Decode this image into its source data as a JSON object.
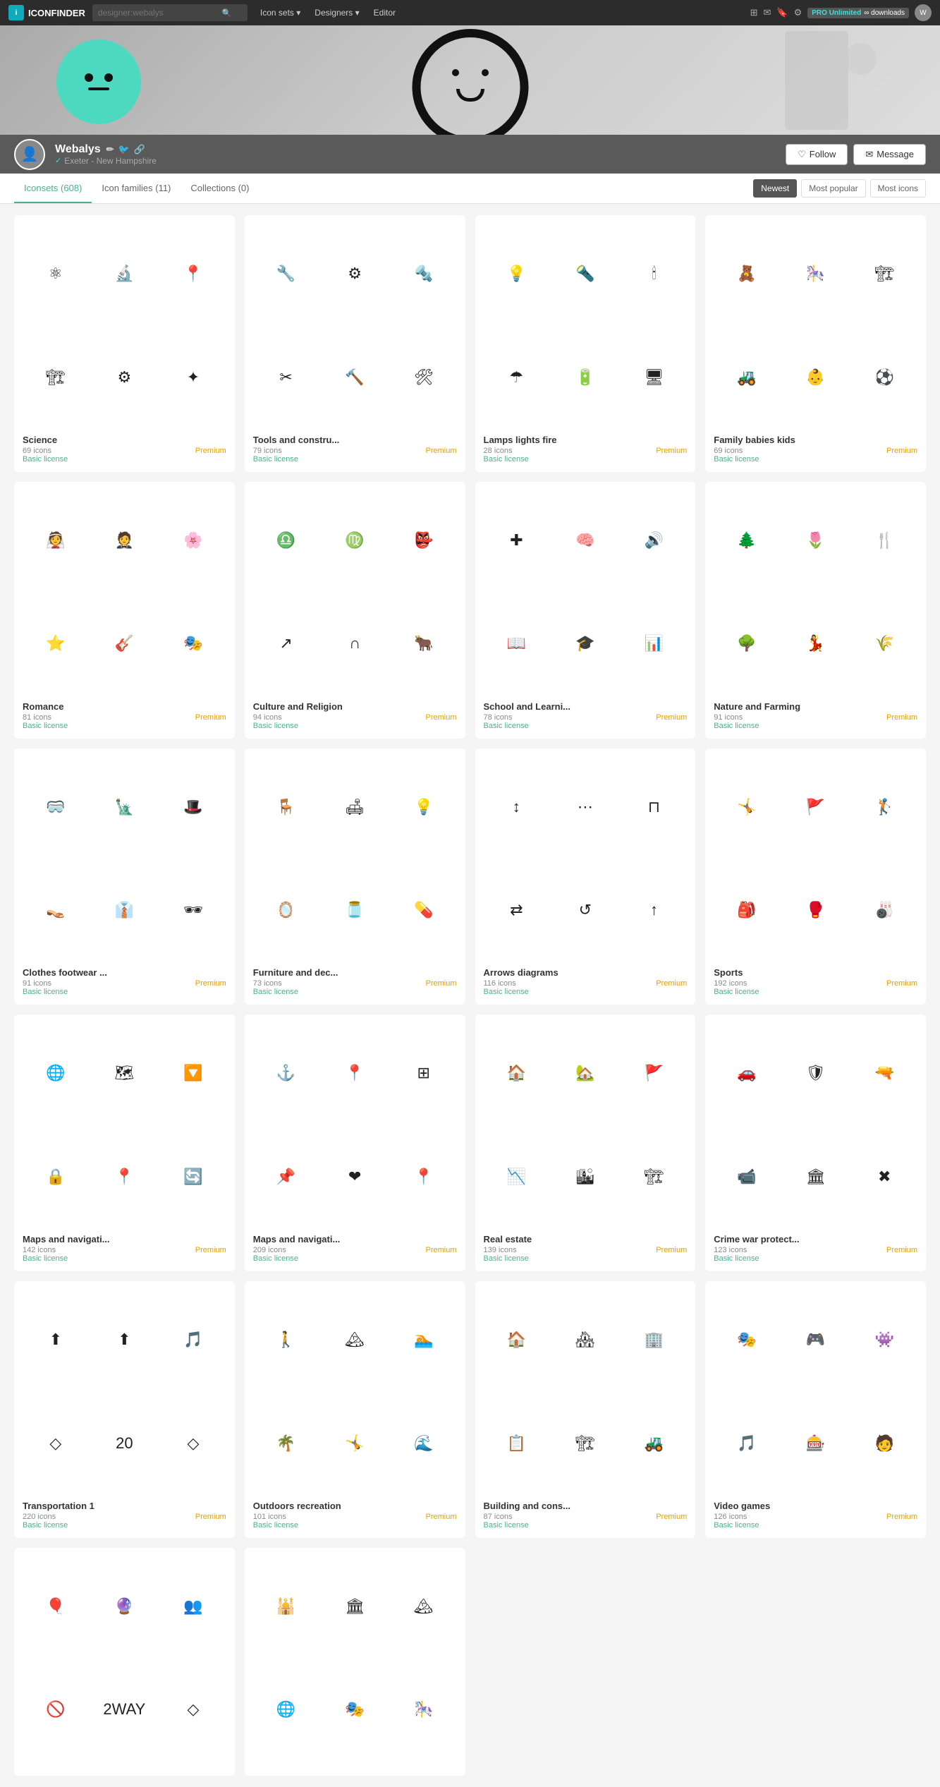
{
  "nav": {
    "logo": "ICONFINDER",
    "search_placeholder": "designer:webalys",
    "links": [
      {
        "label": "Icon sets",
        "has_dropdown": true
      },
      {
        "label": "Designers",
        "has_dropdown": true
      },
      {
        "label": "Editor",
        "has_dropdown": false
      }
    ],
    "pro_label": "PRO Unlimited",
    "pro_sub": "∞ downloads"
  },
  "profile": {
    "name": "Webalys",
    "location": "Exeter - New Hampshire",
    "follow_label": "Follow",
    "message_label": "Message"
  },
  "tabs": {
    "items": [
      {
        "label": "Iconsets (608)",
        "active": true
      },
      {
        "label": "Icon families (11)",
        "active": false
      },
      {
        "label": "Collections (0)",
        "active": false
      }
    ],
    "sort": [
      {
        "label": "Newest",
        "active": true
      },
      {
        "label": "Most popular",
        "active": false
      },
      {
        "label": "Most icons",
        "active": false
      }
    ]
  },
  "cards": [
    {
      "title": "Science",
      "count": "69 icons",
      "badge": "Premium",
      "license": "Basic license",
      "icons": [
        "⚛",
        "🔬",
        "📍",
        "🏗",
        "⚙",
        "✦"
      ]
    },
    {
      "title": "Tools and constru...",
      "count": "79 icons",
      "badge": "Premium",
      "license": "Basic license",
      "icons": [
        "🔧",
        "⚙",
        "🔩",
        "✂",
        "🔨",
        "🛠"
      ]
    },
    {
      "title": "Lamps lights fire",
      "count": "28 icons",
      "badge": "Premium",
      "license": "Basic license",
      "icons": [
        "💡",
        "🔦",
        "🕯",
        "☂",
        "🔋",
        "🖥"
      ]
    },
    {
      "title": "Family babies kids",
      "count": "69 icons",
      "badge": "Premium",
      "license": "Basic license",
      "icons": [
        "🧸",
        "🎠",
        "🏗",
        "🚜",
        "👶",
        "⚽"
      ]
    },
    {
      "title": "Romance",
      "count": "81 icons",
      "badge": "Premium",
      "license": "Basic license",
      "icons": [
        "👰",
        "🤵",
        "🌸",
        "⭐",
        "🎸",
        "🎭"
      ]
    },
    {
      "title": "Culture and Religion",
      "count": "94 icons",
      "badge": "Premium",
      "license": "Basic license",
      "icons": [
        "♎",
        "♍",
        "👺",
        "↗",
        "∩",
        "🐂"
      ]
    },
    {
      "title": "School and Learni...",
      "count": "78 icons",
      "badge": "Premium",
      "license": "Basic license",
      "icons": [
        "✚",
        "🧠",
        "🔊",
        "📖",
        "🎓",
        "📊"
      ]
    },
    {
      "title": "Nature and Farming",
      "count": "91 icons",
      "badge": "Premium",
      "license": "Basic license",
      "icons": [
        "🌲",
        "🌷",
        "🍴",
        "🌳",
        "💃",
        "🌾"
      ]
    },
    {
      "title": "Clothes footwear ...",
      "count": "91 icons",
      "badge": "Premium",
      "license": "Basic license",
      "icons": [
        "🥽",
        "🗽",
        "🎩",
        "👡",
        "👔",
        "🕶"
      ]
    },
    {
      "title": "Furniture and dec...",
      "count": "73 icons",
      "badge": "Premium",
      "license": "Basic license",
      "icons": [
        "🪑",
        "🛋",
        "💡",
        "🪞",
        "🫙",
        "💊"
      ]
    },
    {
      "title": "Arrows diagrams",
      "count": "116 icons",
      "badge": "Premium",
      "license": "Basic license",
      "icons": [
        "↕",
        "⋯",
        "⊓",
        "⇄",
        "↺",
        "↑"
      ]
    },
    {
      "title": "Sports",
      "count": "192 icons",
      "badge": "Premium",
      "license": "Basic license",
      "icons": [
        "🤸",
        "🚩",
        "🏌",
        "🎒",
        "🥊",
        "🎳"
      ]
    },
    {
      "title": "Maps and navigati...",
      "count": "142 icons",
      "badge": "Premium",
      "license": "Basic license",
      "icons": [
        "🌐",
        "🗺",
        "🔽",
        "🔒",
        "📍",
        "🔄"
      ]
    },
    {
      "title": "Maps and navigati...",
      "count": "209 icons",
      "badge": "Premium",
      "license": "Basic license",
      "icons": [
        "⚓",
        "📍",
        "⊞",
        "📌",
        "❤",
        "📍"
      ]
    },
    {
      "title": "Real estate",
      "count": "139 icons",
      "badge": "Premium",
      "license": "Basic license",
      "icons": [
        "🏠",
        "🏡",
        "🚩",
        "📉",
        "🏙",
        "🏗"
      ]
    },
    {
      "title": "Crime war protect...",
      "count": "123 icons",
      "badge": "Premium",
      "license": "Basic license",
      "icons": [
        "🚗",
        "🛡",
        "🔫",
        "📹",
        "🏛",
        "✖"
      ]
    },
    {
      "title": "Transportation 1",
      "count": "220 icons",
      "badge": "Premium",
      "license": "Basic license",
      "icons": [
        "⬆",
        "⬆",
        "🎵",
        "◇",
        "20",
        "◇"
      ]
    },
    {
      "title": "Outdoors recreation",
      "count": "101 icons",
      "badge": "Premium",
      "license": "Basic license",
      "icons": [
        "🚶",
        "🏔",
        "🏊",
        "🌴",
        "🤸",
        "🌊"
      ]
    },
    {
      "title": "Building and cons...",
      "count": "87 icons",
      "badge": "Premium",
      "license": "Basic license",
      "icons": [
        "🏠",
        "🏘",
        "🏢",
        "📋",
        "🏗",
        "🚜"
      ]
    },
    {
      "title": "Video games",
      "count": "126 icons",
      "badge": "Premium",
      "license": "Basic license",
      "icons": [
        "🎭",
        "🎮",
        "👾",
        "🎵",
        "🎰",
        "🧑"
      ]
    },
    {
      "title": "",
      "count": "",
      "badge": "",
      "license": "",
      "icons": [
        "🎈",
        "🔮",
        "👥",
        "🚫",
        "2WAY",
        "◇"
      ]
    },
    {
      "title": "",
      "count": "",
      "badge": "",
      "license": "",
      "icons": [
        "🕌",
        "🏛",
        "🏔",
        "🌐",
        "🎭",
        "🎠"
      ]
    },
    {
      "title": "",
      "count": "",
      "badge": "",
      "license": "",
      "icons": [
        "",
        "",
        "",
        "",
        "",
        ""
      ]
    },
    {
      "title": "",
      "count": "",
      "badge": "",
      "license": "",
      "icons": [
        "",
        "",
        "",
        "",
        "",
        ""
      ]
    }
  ]
}
